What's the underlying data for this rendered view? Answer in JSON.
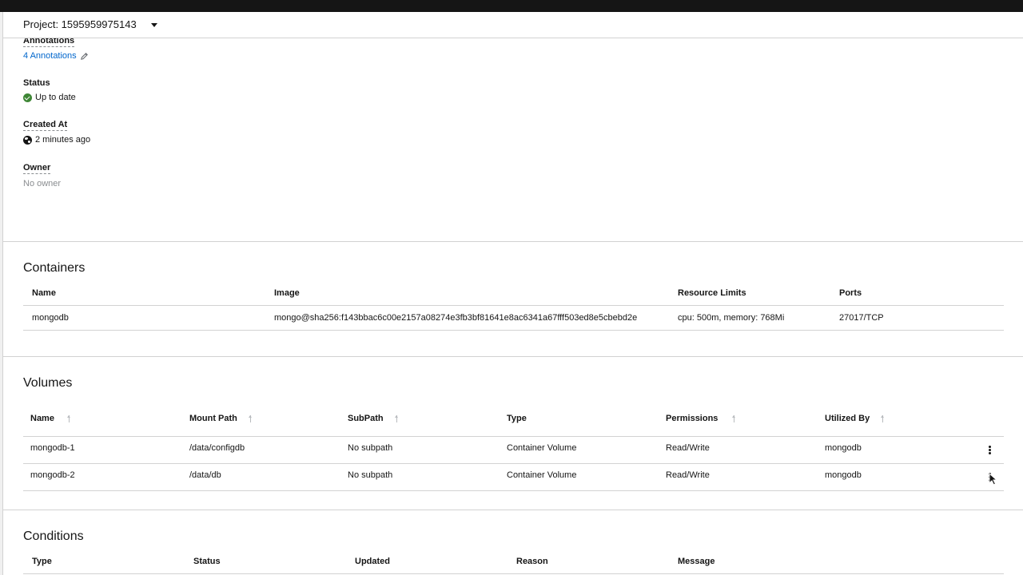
{
  "project": {
    "label": "Project: 1595959975143"
  },
  "details": {
    "annotations": {
      "term": "Annotations",
      "value": "4 Annotations"
    },
    "status": {
      "term": "Status",
      "value": "Up to date"
    },
    "created": {
      "term": "Created At",
      "value": "2 minutes ago"
    },
    "owner": {
      "term": "Owner",
      "value": "No owner"
    }
  },
  "containers": {
    "title": "Containers",
    "headers": {
      "name": "Name",
      "image": "Image",
      "limits": "Resource Limits",
      "ports": "Ports"
    },
    "rows": [
      {
        "name": "mongodb",
        "image": "mongo@sha256:f143bbac6c00e2157a08274e3fb3bf81641e8ac6341a67fff503ed8e5cbebd2e",
        "limits": "cpu: 500m, memory: 768Mi",
        "ports": "27017/TCP"
      }
    ]
  },
  "volumes": {
    "title": "Volumes",
    "headers": {
      "name": "Name",
      "mount": "Mount Path",
      "subpath": "SubPath",
      "type": "Type",
      "permissions": "Permissions",
      "utilized": "Utilized By"
    },
    "rows": [
      {
        "name": "mongodb-1",
        "mount": "/data/configdb",
        "subpath": "No subpath",
        "type": "Container Volume",
        "permissions": "Read/Write",
        "utilized": "mongodb"
      },
      {
        "name": "mongodb-2",
        "mount": "/data/db",
        "subpath": "No subpath",
        "type": "Container Volume",
        "permissions": "Read/Write",
        "utilized": "mongodb"
      }
    ]
  },
  "conditions": {
    "title": "Conditions",
    "headers": {
      "type": "Type",
      "status": "Status",
      "updated": "Updated",
      "reason": "Reason",
      "message": "Message"
    }
  }
}
